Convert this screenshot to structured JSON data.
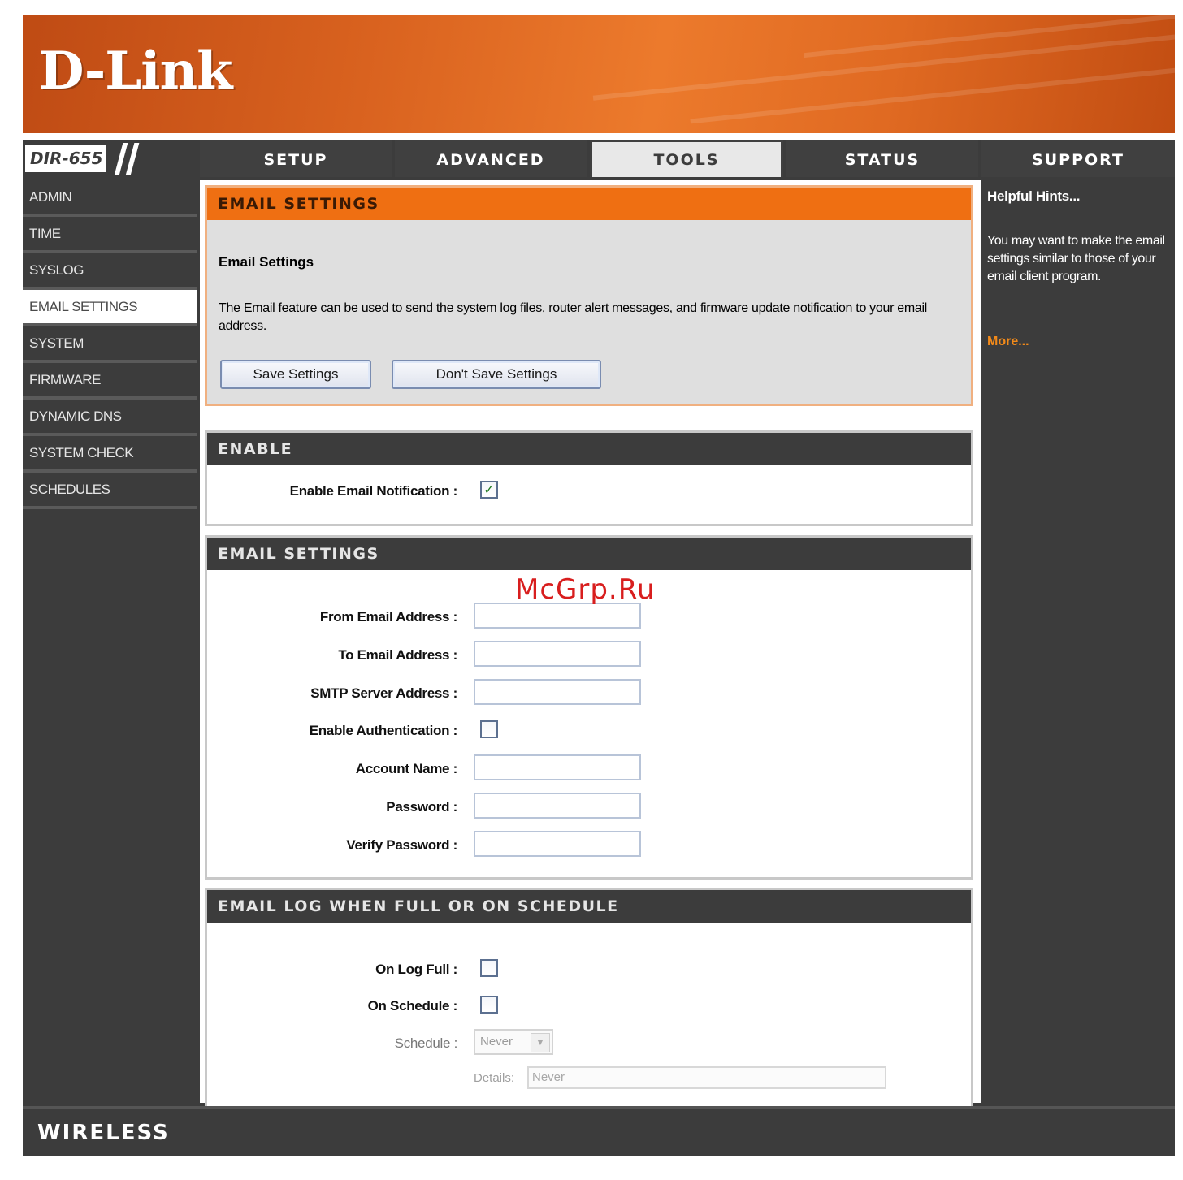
{
  "brand": {
    "logo": "D-Link",
    "model": "DIR-655",
    "colors": {
      "orange": "#ef6f12",
      "dark": "#3c3c3c",
      "link": "#f28a1a"
    }
  },
  "tabs": [
    {
      "label": "SETUP",
      "active": false
    },
    {
      "label": "ADVANCED",
      "active": false
    },
    {
      "label": "TOOLS",
      "active": true
    },
    {
      "label": "STATUS",
      "active": false
    },
    {
      "label": "SUPPORT",
      "active": false
    }
  ],
  "sidebar": {
    "items": [
      {
        "label": "ADMIN"
      },
      {
        "label": "TIME"
      },
      {
        "label": "SYSLOG"
      },
      {
        "label": "EMAIL SETTINGS",
        "active": true
      },
      {
        "label": "SYSTEM"
      },
      {
        "label": "FIRMWARE"
      },
      {
        "label": "DYNAMIC DNS"
      },
      {
        "label": "SYSTEM CHECK"
      },
      {
        "label": "SCHEDULES"
      }
    ]
  },
  "intro": {
    "header": "EMAIL SETTINGS",
    "title": "Email Settings",
    "description": "The Email feature can be used to send the system log files, router alert messages, and firmware update notification to your email address.",
    "save_label": "Save Settings",
    "dont_save_label": "Don't Save Settings"
  },
  "enable": {
    "header": "ENABLE",
    "notification_label": "Enable Email Notification :",
    "notification_checked": true
  },
  "email": {
    "header": "EMAIL SETTINGS",
    "from_label": "From Email Address :",
    "from_value": "",
    "to_label": "To Email Address :",
    "to_value": "",
    "smtp_label": "SMTP Server Address :",
    "smtp_value": "",
    "auth_label": "Enable Authentication :",
    "auth_checked": false,
    "account_label": "Account Name :",
    "account_value": "",
    "password_label": "Password :",
    "verify_label": "Verify Password :"
  },
  "log": {
    "header": "EMAIL LOG WHEN FULL OR ON SCHEDULE",
    "log_full_label": "On Log Full :",
    "log_full_checked": false,
    "on_schedule_label": "On Schedule :",
    "on_schedule_checked": false,
    "schedule_label": "Schedule :",
    "schedule_value": "Never",
    "details_label": "Details:",
    "details_value": "Never"
  },
  "hints": {
    "title": "Helpful Hints...",
    "text": "You may want to make the email settings similar to those of your email client program.",
    "more": "More..."
  },
  "footer": {
    "text": "WIRELESS"
  },
  "watermark": "McGrp.Ru"
}
